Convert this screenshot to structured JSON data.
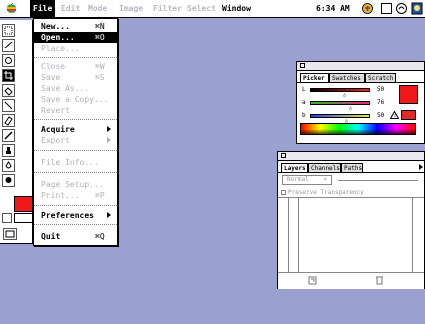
{
  "menubar": {
    "items": [
      "File",
      "Edit",
      "Mode",
      "Image",
      "Filter",
      "Select",
      "Window"
    ],
    "clock": "6:34 AM"
  },
  "file_menu": {
    "items": [
      {
        "label": "New...",
        "shortcut": "⌘N",
        "enabled": true
      },
      {
        "label": "Open...",
        "shortcut": "⌘O",
        "enabled": true,
        "highlighted": true
      },
      {
        "label": "Place...",
        "shortcut": "",
        "enabled": false
      },
      {
        "label": "Close",
        "shortcut": "⌘W",
        "enabled": false
      },
      {
        "label": "Save",
        "shortcut": "⌘S",
        "enabled": false
      },
      {
        "label": "Save As...",
        "shortcut": "",
        "enabled": false
      },
      {
        "label": "Save a Copy...",
        "shortcut": "",
        "enabled": false
      },
      {
        "label": "Revert",
        "shortcut": "",
        "enabled": false
      },
      {
        "label": "Acquire",
        "shortcut": "",
        "enabled": true,
        "submenu": true
      },
      {
        "label": "Export",
        "shortcut": "",
        "enabled": false,
        "submenu": true
      },
      {
        "label": "File Info...",
        "shortcut": "",
        "enabled": false
      },
      {
        "label": "Page Setup...",
        "shortcut": "",
        "enabled": false
      },
      {
        "label": "Print...",
        "shortcut": "⌘P",
        "enabled": false
      },
      {
        "label": "Preferences",
        "shortcut": "",
        "enabled": true,
        "submenu": true
      },
      {
        "label": "Quit",
        "shortcut": "⌘Q",
        "enabled": true
      }
    ]
  },
  "picker_palette": {
    "tabs": [
      "Picker",
      "Swatches",
      "Scratch"
    ],
    "channels": [
      {
        "label": "L",
        "value": "50"
      },
      {
        "label": "a",
        "value": "76"
      },
      {
        "label": "b",
        "value": "50"
      }
    ],
    "current_color": "#f01818"
  },
  "layers_palette": {
    "tabs": [
      "Layers",
      "Channels",
      "Paths"
    ],
    "mode": "Normal",
    "preserve_transparency": "Preserve Transparency"
  },
  "colors": {
    "desktop": "#9aa0cf",
    "foreground": "#f01818",
    "background": "#ffffff"
  }
}
